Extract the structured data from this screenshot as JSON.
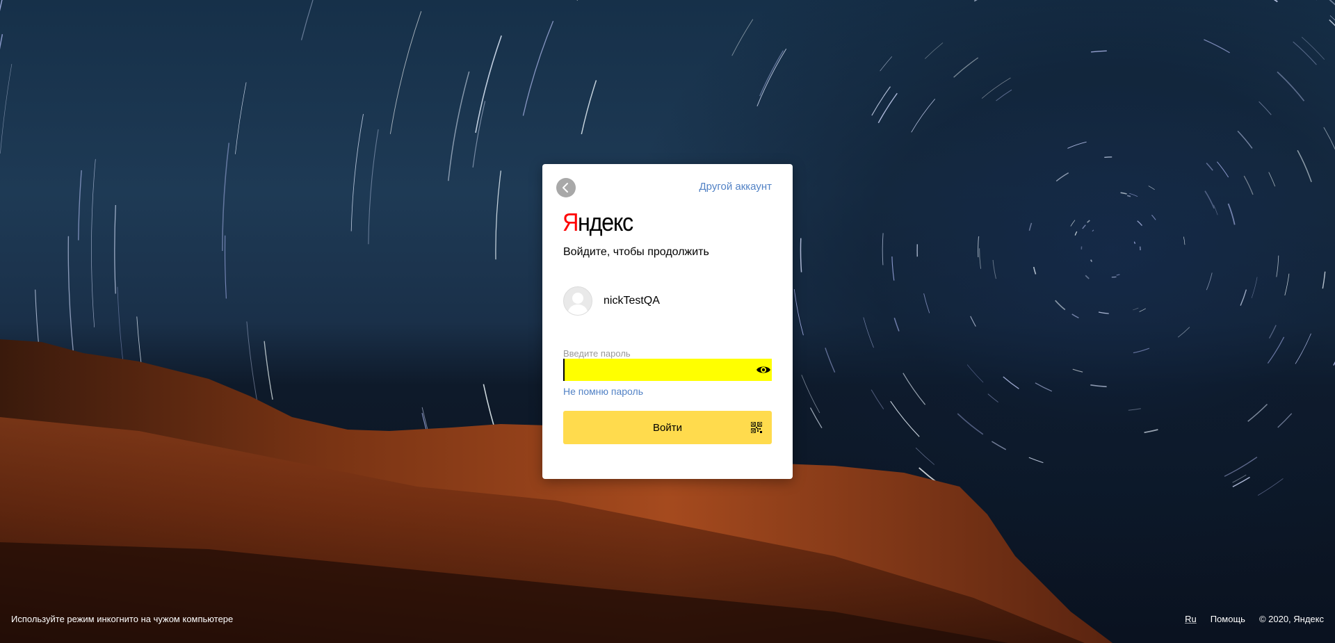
{
  "header": {
    "back_icon": "chevron-left-icon",
    "other_account_label": "Другой аккаунт"
  },
  "brand": {
    "logo_first_letter": "Я",
    "logo_rest": "ндекс",
    "logo_color_first": "#ff0000"
  },
  "login": {
    "subtitle": "Войдите, чтобы продолжить",
    "username": "nickTestQA",
    "password_label": "Введите пароль",
    "password_value": "",
    "password_field_color": "#ffff00",
    "show_password_icon": "eye-icon",
    "forgot_label": "Не помню пароль",
    "submit_label": "Войти",
    "submit_color": "#ffdb4d",
    "qr_icon": "qr-code-icon"
  },
  "footer": {
    "incognito_hint": "Используйте режим инкогнито на чужом компьютере",
    "language": "Ru",
    "help": "Помощь",
    "copyright": "© 2020, Яндекс"
  },
  "colors": {
    "link": "#5282c5"
  }
}
